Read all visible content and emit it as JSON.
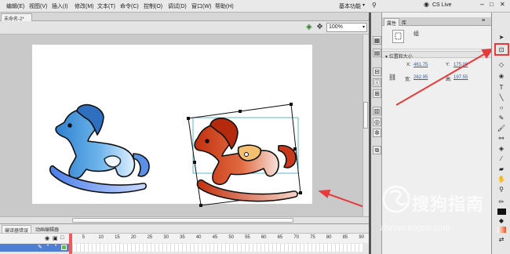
{
  "menu": {
    "items": [
      "编辑(E)",
      "视图(V)",
      "插入(I)",
      "修改(M)",
      "文本(T)",
      "命令(C)",
      "控制(O)",
      "调试(D)",
      "窗口(W)",
      "帮助(H)"
    ],
    "workspace": "基本功能",
    "live": "CS Live"
  },
  "document": {
    "tab": "未命名-2*",
    "zoom": "100%"
  },
  "timeline": {
    "tabs": [
      "编译器错误",
      "动画编辑器"
    ],
    "frame_numbers": [
      "1",
      "5",
      "10",
      "15",
      "20",
      "25",
      "30",
      "35",
      "40",
      "45",
      "50",
      "55",
      "60",
      "65",
      "70",
      "75",
      "80",
      "85",
      "90"
    ]
  },
  "properties": {
    "tabs": [
      "属性",
      "库"
    ],
    "symbol_name": "组",
    "section": "位置和大小",
    "x_label": "X:",
    "x_value": "461.75",
    "y_label": "Y:",
    "y_value": "175.00",
    "w_label": "宽:",
    "w_value": "262.95",
    "h_label": "高:",
    "h_value": "197.55"
  },
  "watermark": {
    "brand": "搜狗指南",
    "url": "zhinan.sogou.com"
  },
  "colors": {
    "horse_left": "#3b8fd6",
    "horse_right": "#c83a14",
    "annotation": "#e83a3a",
    "selection": "#5cb8c8"
  }
}
